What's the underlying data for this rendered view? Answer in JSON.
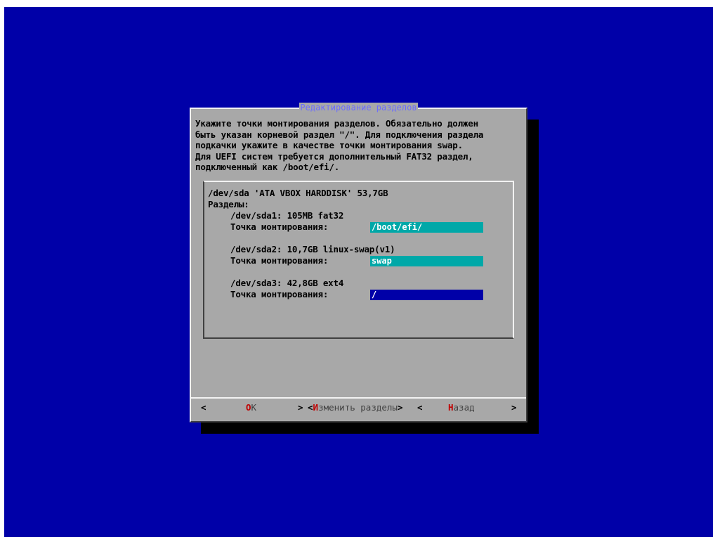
{
  "dialog": {
    "title": "Редактирование разделов",
    "description": "Укажите точки монтирования разделов. Обязательно должен\nбыть указан корневой раздел \"/\". Для подключения раздела\nподкачки укажите в качестве точки монтирования swap.\nДля UEFI систем требуется дополнительный FAT32 раздел,\nподключенный как /boot/efi/."
  },
  "disk": {
    "header": "/dev/sda 'ATA VBOX HARDDISK' 53,7GB",
    "partitions_label": "Разделы:",
    "partitions": [
      {
        "info": "/dev/sda1: 105MB fat32",
        "mount_label": "Точка монтирования:",
        "mount_value": "/boot/efi/"
      },
      {
        "info": "/dev/sda2: 10,7GB linux-swap(v1)",
        "mount_label": "Точка монтирования:",
        "mount_value": "swap"
      },
      {
        "info": "/dev/sda3: 42,8GB ext4",
        "mount_label": "Точка монтирования:",
        "mount_value": "/"
      }
    ]
  },
  "buttons": {
    "scroll_left": "<",
    "scroll_right": ">",
    "ok": {
      "hotkey": "O",
      "rest": "K"
    },
    "edit": {
      "open": "<",
      "hotkey": "И",
      "rest": "зменить разделы",
      "close": ">",
      "left_arrow": ">",
      "right_arrow": "<"
    },
    "back": {
      "hotkey": "Н",
      "rest": "азад"
    }
  },
  "colors": {
    "background": "#0000a8",
    "dialog": "#a8a8a8",
    "title": "#6b6bff",
    "field_inactive": "#00a8a8",
    "field_active": "#0000a8",
    "hotkey": "#c00000"
  }
}
